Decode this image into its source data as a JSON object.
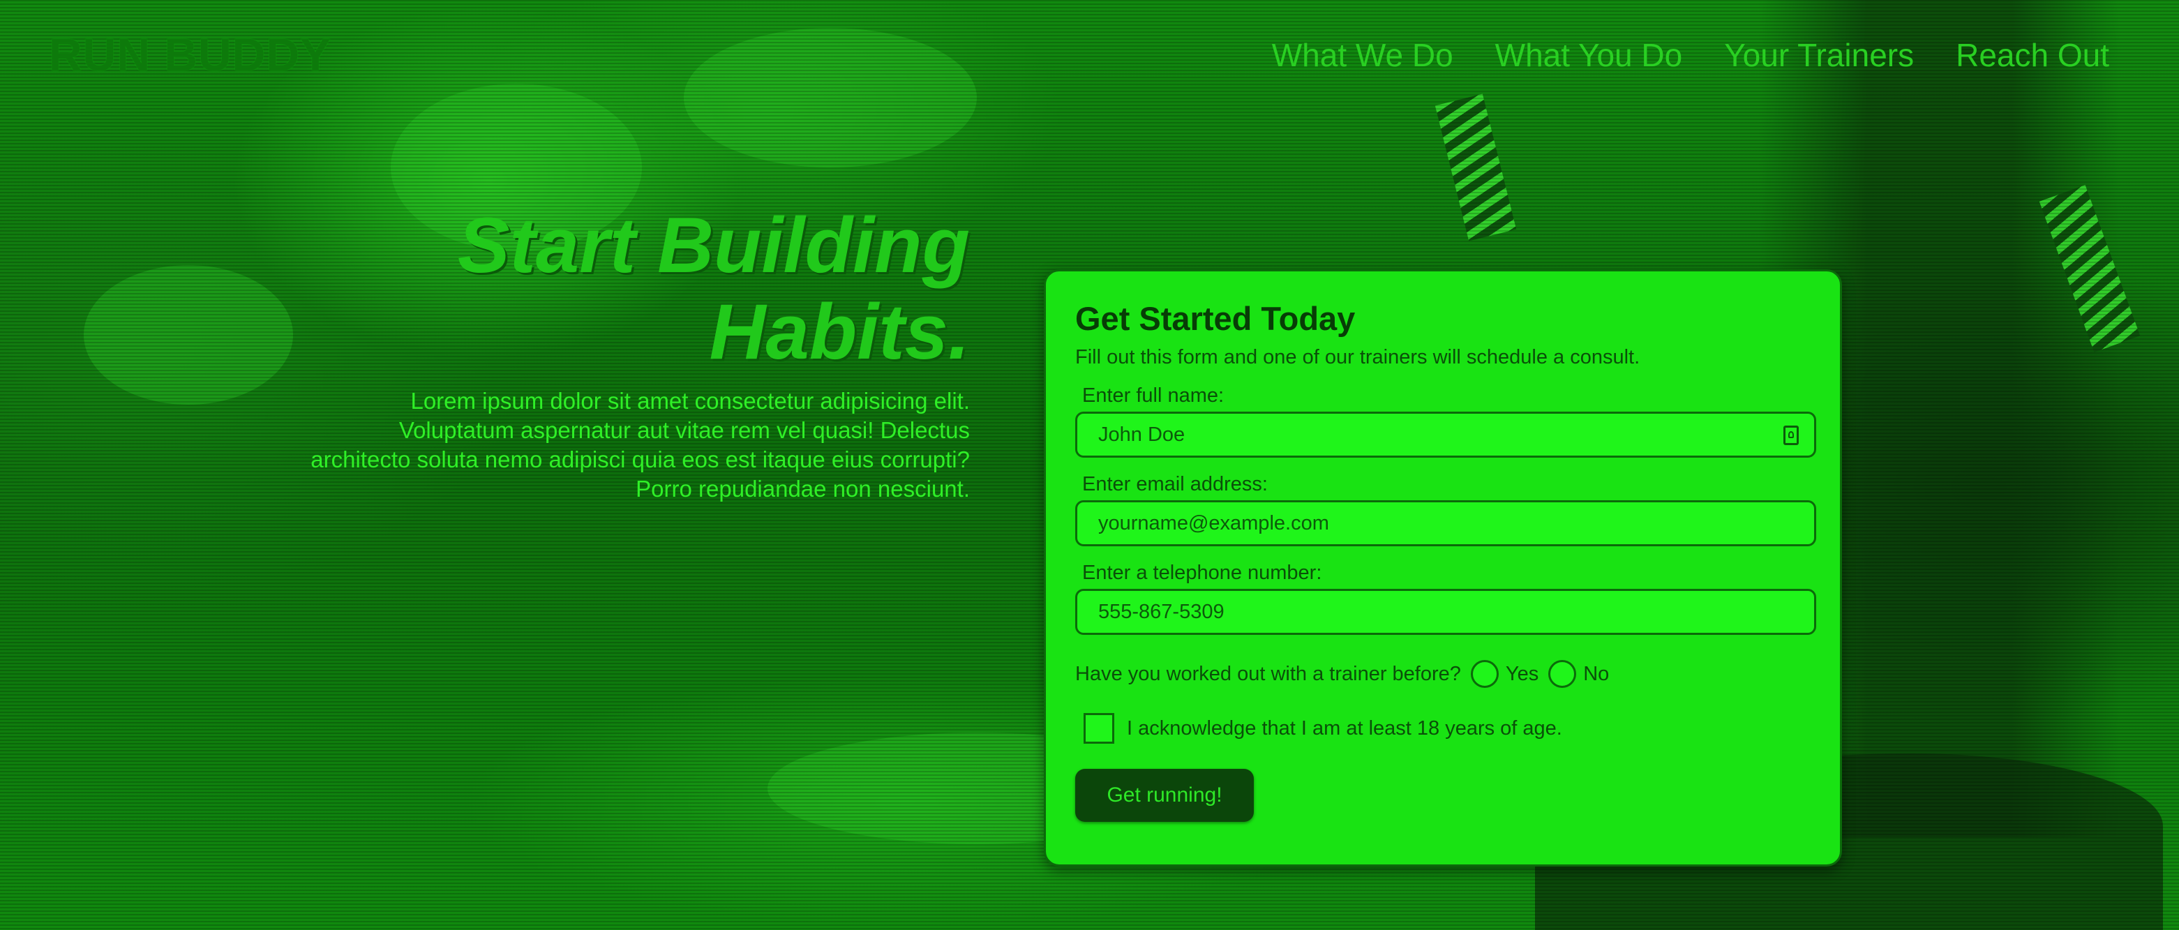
{
  "brand": "RUN BUDDY",
  "nav": [
    "What We Do",
    "What You Do",
    "Your Trainers",
    "Reach Out"
  ],
  "hero": {
    "title": "Start Building Habits.",
    "text": "Lorem ipsum dolor sit amet consectetur adipisicing elit. Voluptatum aspernatur aut vitae rem vel quasi! Delectus architecto soluta nemo adipisci quia eos est itaque eius corrupti? Porro repudiandae non nesciunt."
  },
  "form": {
    "title": "Get Started Today",
    "subtitle": "Fill out this form and one of our trainers will schedule a consult.",
    "name_label": "Enter full name:",
    "name_placeholder": "John Doe",
    "email_label": "Enter email address:",
    "email_placeholder": "yourname@example.com",
    "phone_label": "Enter a telephone number:",
    "phone_placeholder": "555-867-5309",
    "trainer_question": "Have you worked out with a trainer before?",
    "yes_label": "Yes",
    "no_label": "No",
    "ack_label": "I acknowledge that I am at least 18 years of age.",
    "submit_label": "Get running!"
  },
  "colors": {
    "tint": "#19e313",
    "dark": "#0b460a",
    "accent": "#29d022"
  }
}
